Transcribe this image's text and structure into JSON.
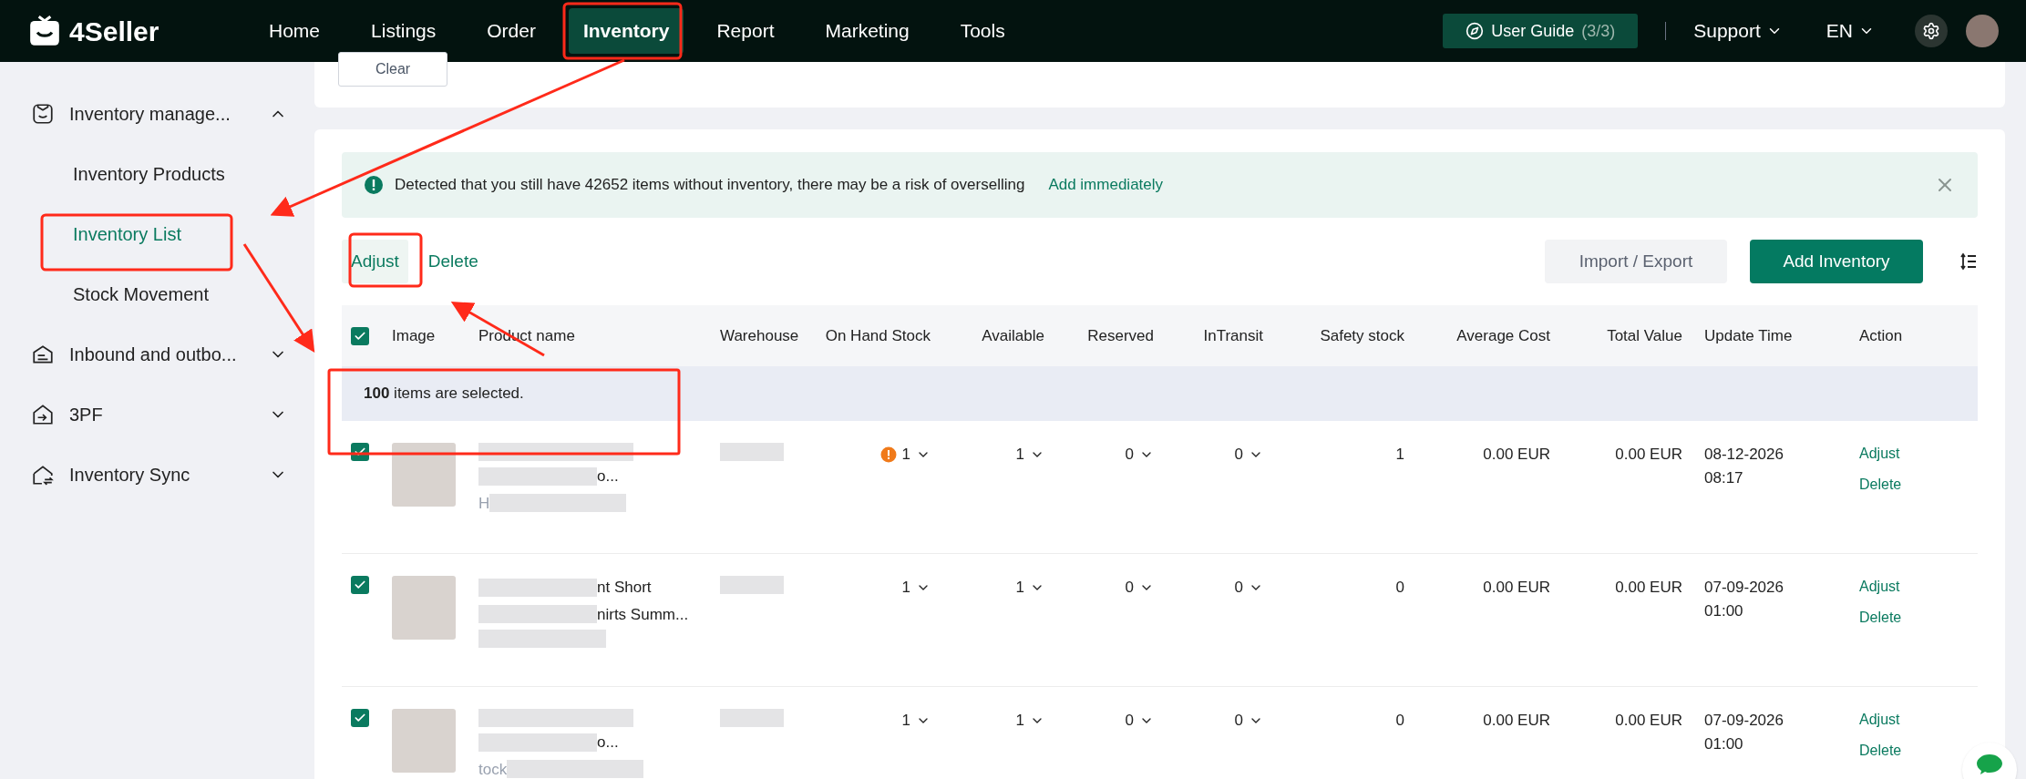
{
  "brand": "4Seller",
  "nav": [
    {
      "label": "Home",
      "selected": false
    },
    {
      "label": "Listings",
      "selected": false
    },
    {
      "label": "Order",
      "selected": false
    },
    {
      "label": "Inventory",
      "selected": true
    },
    {
      "label": "Report",
      "selected": false
    },
    {
      "label": "Marketing",
      "selected": false
    },
    {
      "label": "Tools",
      "selected": false
    }
  ],
  "user_guide": {
    "label": "User Guide",
    "count": "(3/3)"
  },
  "support": "Support",
  "language": "EN",
  "filter": {
    "clear": "Clear"
  },
  "sidebar": [
    {
      "label": "Inventory manage...",
      "expanded": true,
      "children": [
        {
          "label": "Inventory Products",
          "selected": false
        },
        {
          "label": "Inventory List",
          "selected": true
        },
        {
          "label": "Stock Movement",
          "selected": false
        }
      ]
    },
    {
      "label": "Inbound and outbo...",
      "expanded": false
    },
    {
      "label": "3PF",
      "expanded": false
    },
    {
      "label": "Inventory Sync",
      "expanded": false
    }
  ],
  "alert": {
    "text": "Detected that you still have 42652 items without inventory, there may be a risk of overselling",
    "link": "Add immediately"
  },
  "toolbar": {
    "actions": [
      {
        "label": "Adjust",
        "hovered": true
      },
      {
        "label": "Delete",
        "hovered": false
      }
    ],
    "import_export": "Import / Export",
    "add": "Add Inventory"
  },
  "table": {
    "all_checked": true,
    "columns": [
      "Image",
      "Product name",
      "Warehouse",
      "On Hand Stock",
      "Available",
      "Reserved",
      "InTransit",
      "Safety stock",
      "Average Cost",
      "Total Value",
      "Update Time",
      "Action"
    ],
    "selection_banner": "**100** items are selected.",
    "rows": [
      {
        "checked": true,
        "name_lines": [
          "o..."
        ],
        "subtext": "H",
        "on_hand": {
          "value": "1",
          "warning": true
        },
        "available": "1",
        "reserved": "0",
        "in_transit": "0",
        "safety_stock": "1",
        "average_cost": "0.00 EUR",
        "total_value": "0.00 EUR",
        "update_time": [
          "08-12-2026",
          "08:17"
        ],
        "actions": [
          "Adjust",
          "Delete"
        ]
      },
      {
        "checked": true,
        "name_lines": [
          "nt Short",
          "nirts Summ..."
        ],
        "on_hand": {
          "value": "1",
          "warning": false
        },
        "available": "1",
        "reserved": "0",
        "in_transit": "0",
        "safety_stock": "0",
        "average_cost": "0.00 EUR",
        "total_value": "0.00 EUR",
        "update_time": [
          "07-09-2026",
          "01:00"
        ],
        "actions": [
          "Adjust",
          "Delete"
        ]
      },
      {
        "checked": true,
        "name_lines": [
          "o..."
        ],
        "subtext": "tock",
        "on_hand": {
          "value": "1",
          "warning": false
        },
        "available": "1",
        "reserved": "0",
        "in_transit": "0",
        "safety_stock": "0",
        "average_cost": "0.00 EUR",
        "total_value": "0.00 EUR",
        "update_time": [
          "07-09-2026",
          "01:00"
        ],
        "actions": [
          "Adjust",
          "Delete"
        ]
      }
    ]
  }
}
